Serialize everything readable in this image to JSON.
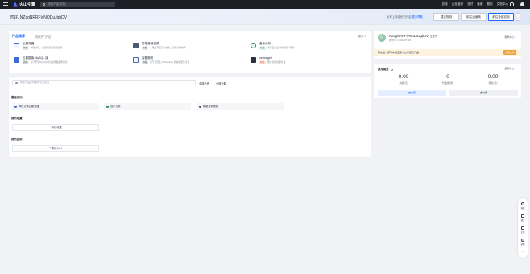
{
  "topbar": {
    "logo": "火山引擎",
    "search_placeholder": "搜索产品/文档",
    "nav": [
      "总线",
      "企业组织",
      "支付",
      "备案",
      "费用",
      "文档中心"
    ]
  },
  "header": {
    "greeting": "您好, NZcgNRRFiyNODuJgbDV",
    "note_prefix": "私有上传组织已开启",
    "note_link": "更多帮助",
    "btn_primary_1": "建议规划",
    "btn_primary_2": "前往运营商",
    "btn_primary_3": "前往全部应用",
    "btn_more": "▢"
  },
  "products": {
    "title_blue": "产品推荐",
    "subtitle": "推荐热门产品",
    "more": "更多 >",
    "items": [
      {
        "name": "云服务器",
        "tag": "新客",
        "desc": "弹性计算，按需购买和使用资源",
        "color": "#4b6bd6"
      },
      {
        "name": "智能营销视频",
        "tag": "新客",
        "desc": "多维度产品演示方案，提升营销效率",
        "color": "#4a5a73"
      },
      {
        "name": "音乐分析",
        "tag": "免费",
        "desc": "为产品认证AI智能语义检测",
        "color": "#2f8a6a"
      },
      {
        "name": "云数据库 MySQL 版",
        "tag": "新客",
        "desc": "基于开源MySQL的高性能数据库服务",
        "color": "#3a6bd6"
      },
      {
        "name": "容器服务",
        "tag": "新客",
        "desc": "基于云原生 Kubernetes 的容器服务平台",
        "color": "#5068a8"
      },
      {
        "name": "veImageX",
        "tag": "热卖",
        "desc": "图片智能处理分发",
        "color": "#2c3140"
      }
    ]
  },
  "account": {
    "avatar_letter": "N",
    "name": "NZcgNRRFiyNODuJgbDV",
    "badge": "主账号",
    "id": "账号ID: 2100207796",
    "manage": "账号中心 >",
    "banner_text": "首充后，即可体验更多火山引擎云产品",
    "banner_btn": "立即充值"
  },
  "fee": {
    "title": "费用概览",
    "manage": "费用中心 >",
    "items": [
      {
        "value": "0.00",
        "label": "余额(元)"
      },
      {
        "value": "0",
        "label": "代金券(张)"
      },
      {
        "value": "0.00",
        "label": "待付(元)"
      }
    ],
    "btn_recharge": "去充值",
    "btn_order": "去付费"
  },
  "main": {
    "search_placeholder": "搜索产品名称或者专业名词",
    "link_all": "全部产品",
    "link_recent": "全部近期",
    "sec_recent": "最近访问",
    "quick": [
      {
        "label": "弹性计算云服务器",
        "color": "#3a6bd6"
      },
      {
        "label": "音乐分析",
        "color": "#2f8a6a"
      },
      {
        "label": "智能营销视频",
        "color": "#4a5a73"
      }
    ],
    "sec_fav": "我的收藏",
    "add_fav": "添加收藏",
    "sec_app": "我的应用",
    "add_app": "添加入口"
  },
  "floatbar": [
    "客服",
    "建议",
    "反馈",
    "帮助"
  ]
}
